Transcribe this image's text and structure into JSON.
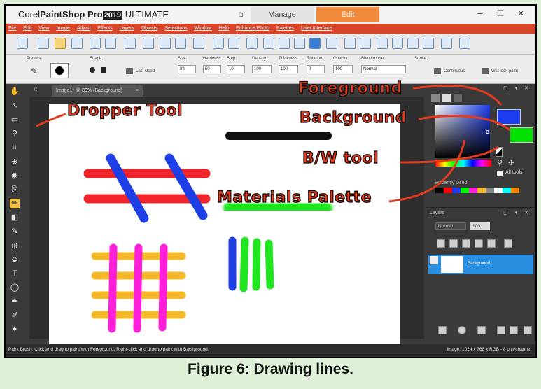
{
  "app": {
    "title_corel": "Corel",
    "title_psp": "PaintShop Pro",
    "title_year": "2019",
    "title_edition": "ULTIMATE"
  },
  "tabs": {
    "manage": "Manage",
    "edit": "Edit"
  },
  "window_controls": "– □ ×",
  "menu": [
    "File",
    "Edit",
    "View",
    "Image",
    "Adjust",
    "Effects",
    "Layers",
    "Objects",
    "Selections",
    "Window",
    "Help",
    "Enhance Photo",
    "Palettes",
    "User Interface"
  ],
  "options": {
    "presets_label": "Presets:",
    "shape_label": "Shape:",
    "last_used": "Last Used",
    "size_label": "Size:",
    "size_value": "28",
    "hardness_label": "Hardness:",
    "hardness_value": "50",
    "step_label": "Step:",
    "step_value": "10",
    "density_label": "Density:",
    "density_value": "100",
    "thickness_label": "Thickness:",
    "thickness_value": "100",
    "rotation_label": "Rotation:",
    "rotation_value": "0",
    "opacity_label": "Opacity:",
    "opacity_value": "100",
    "blend_label": "Blend mode:",
    "blend_value": "Normal",
    "stroke_label": "Stroke:",
    "continuous": "Continuous",
    "wetlook": "Wet look paint"
  },
  "document": {
    "tab_label": "Image1* @ 80% (Background)"
  },
  "materials": {
    "header": "Materials",
    "all_tools": "All tools",
    "recently_used": "Recently Used",
    "foreground_color": "#1c3cf0",
    "background_color": "#00e000"
  },
  "layers": {
    "header": "Layers",
    "blend": "Normal",
    "opacity": "100",
    "layer_name": "Background"
  },
  "status": {
    "left": "Paint Brush: Click and drag to paint with Foreground. Right-click and drag to paint with Background.",
    "right": "Image: 1024 x 768 x RGB - 8 bits/channel"
  },
  "annotations": {
    "dropper": "Dropper Tool",
    "foreground": "Foreground",
    "background": "Background",
    "bw": "B/W tool",
    "materials": "Materials Palette"
  },
  "caption": "Figure 6: Drawing lines.",
  "colors": {
    "menu_red": "#d7462a",
    "edit_orange": "#f08a3c",
    "annotation_red": "#e23b1f",
    "stroke_blue": "#1f3fe6",
    "stroke_red": "#f0242a",
    "stroke_green": "#1fe61f",
    "stroke_magenta": "#ff1fd9",
    "stroke_orange": "#f6b92a"
  }
}
